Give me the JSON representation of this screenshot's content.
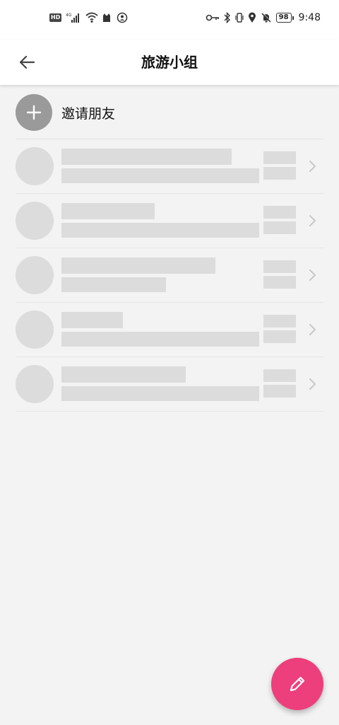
{
  "status_bar": {
    "hd_badge": "HD",
    "network_label": "4G",
    "battery": "98",
    "time": "9:48",
    "icons_left": [
      "hd-icon",
      "signal-icon",
      "wifi-icon",
      "notification-app-icon",
      "notification-app2-icon"
    ],
    "icons_right": [
      "key-icon",
      "bluetooth-icon",
      "vibrate-icon",
      "location-icon",
      "mute-icon",
      "battery-icon"
    ]
  },
  "app_bar": {
    "title": "旅游小组",
    "back_icon": "arrow-left-icon"
  },
  "invite": {
    "label": "邀请朋友",
    "icon": "plus-icon"
  },
  "skeleton_items": [
    {
      "line1_fraction": 0.86,
      "line2_fraction": 1.0
    },
    {
      "line1_fraction": 0.47,
      "line2_fraction": 1.0
    },
    {
      "line1_fraction": 0.78,
      "line2_fraction": 0.53
    },
    {
      "line1_fraction": 0.31,
      "line2_fraction": 1.0
    },
    {
      "line1_fraction": 0.63,
      "line2_fraction": 1.0
    }
  ],
  "fab": {
    "icon": "pencil-icon",
    "color": "#ec3f7b"
  },
  "colors": {
    "background": "#f3f3f3",
    "skeleton": "#dcdcdc",
    "invite_avatar": "#9a9a9a"
  }
}
